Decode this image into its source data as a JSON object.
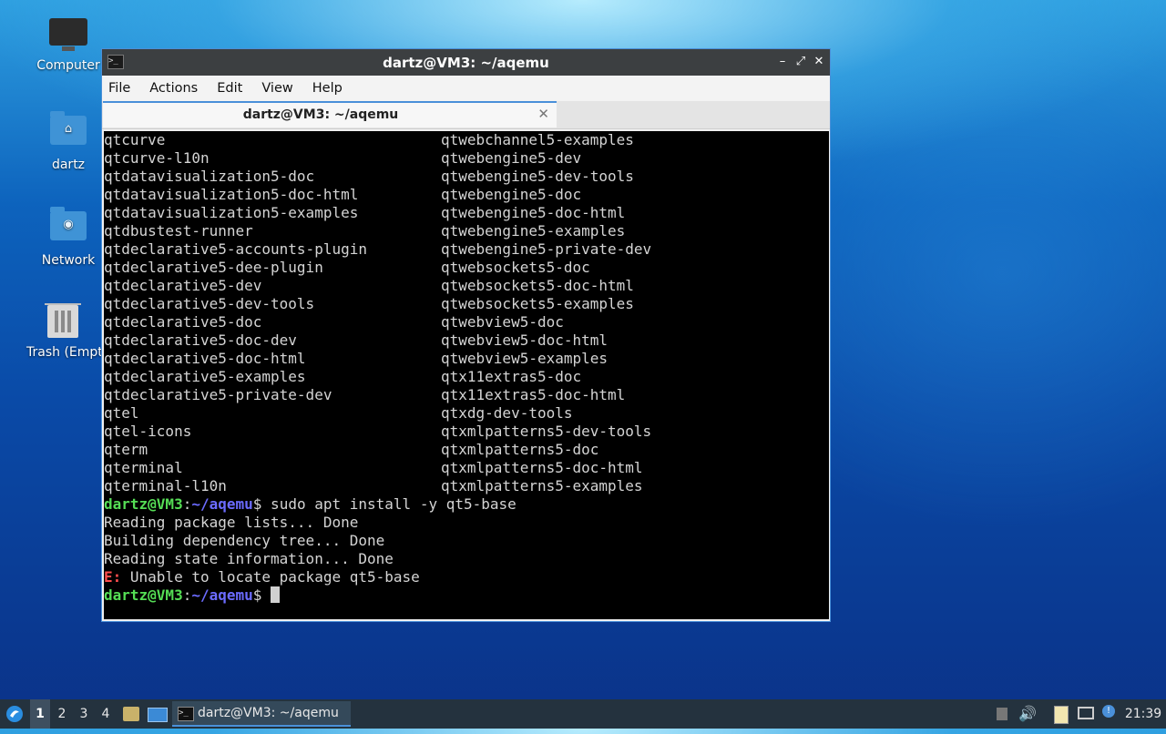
{
  "desktop": {
    "icons": [
      {
        "label": "Computer",
        "icon": "monitor-icon"
      },
      {
        "label": "dartz",
        "icon": "home-folder-icon"
      },
      {
        "label": "Network",
        "icon": "network-folder-icon"
      },
      {
        "label": "Trash (Empt",
        "icon": "trash-icon"
      }
    ]
  },
  "window": {
    "title": "dartz@VM3: ~/aqemu",
    "controls": {
      "minimize": "–",
      "maximize": "⤢",
      "close": "✕"
    },
    "menu": [
      "File",
      "Actions",
      "Edit",
      "View",
      "Help"
    ],
    "tab": {
      "label": "dartz@VM3: ~/aqemu",
      "close": "✕"
    }
  },
  "terminal": {
    "listing": [
      [
        "qtcurve",
        "qtwebchannel5-examples"
      ],
      [
        "qtcurve-l10n",
        "qtwebengine5-dev"
      ],
      [
        "qtdatavisualization5-doc",
        "qtwebengine5-dev-tools"
      ],
      [
        "qtdatavisualization5-doc-html",
        "qtwebengine5-doc"
      ],
      [
        "qtdatavisualization5-examples",
        "qtwebengine5-doc-html"
      ],
      [
        "qtdbustest-runner",
        "qtwebengine5-examples"
      ],
      [
        "qtdeclarative5-accounts-plugin",
        "qtwebengine5-private-dev"
      ],
      [
        "qtdeclarative5-dee-plugin",
        "qtwebsockets5-doc"
      ],
      [
        "qtdeclarative5-dev",
        "qtwebsockets5-doc-html"
      ],
      [
        "qtdeclarative5-dev-tools",
        "qtwebsockets5-examples"
      ],
      [
        "qtdeclarative5-doc",
        "qtwebview5-doc"
      ],
      [
        "qtdeclarative5-doc-dev",
        "qtwebview5-doc-html"
      ],
      [
        "qtdeclarative5-doc-html",
        "qtwebview5-examples"
      ],
      [
        "qtdeclarative5-examples",
        "qtx11extras5-doc"
      ],
      [
        "qtdeclarative5-private-dev",
        "qtx11extras5-doc-html"
      ],
      [
        "qtel",
        "qtxdg-dev-tools"
      ],
      [
        "qtel-icons",
        "qtxmlpatterns5-dev-tools"
      ],
      [
        "qterm",
        "qtxmlpatterns5-doc"
      ],
      [
        "qterminal",
        "qtxmlpatterns5-doc-html"
      ],
      [
        "qterminal-l10n",
        "qtxmlpatterns5-examples"
      ]
    ],
    "prompt_user": "dartz@VM3",
    "prompt_colon": ":",
    "prompt_path": "~/aqemu",
    "prompt_dollar": "$",
    "command": " sudo apt install -y qt5-base",
    "output": [
      "Reading package lists... Done",
      "Building dependency tree... Done",
      "Reading state information... Done"
    ],
    "error_prefix": "E:",
    "error_message": " Unable to locate package qt5-base"
  },
  "taskbar": {
    "workspaces": [
      "1",
      "2",
      "3",
      "4"
    ],
    "active_workspace": "1",
    "task_label": "dartz@VM3: ~/aqemu",
    "clock": "21:39"
  },
  "colors": {
    "prompt_user": "#55dd55",
    "prompt_path": "#6b6bff",
    "error": "#ff4d4d",
    "accent": "#4a90d9"
  }
}
